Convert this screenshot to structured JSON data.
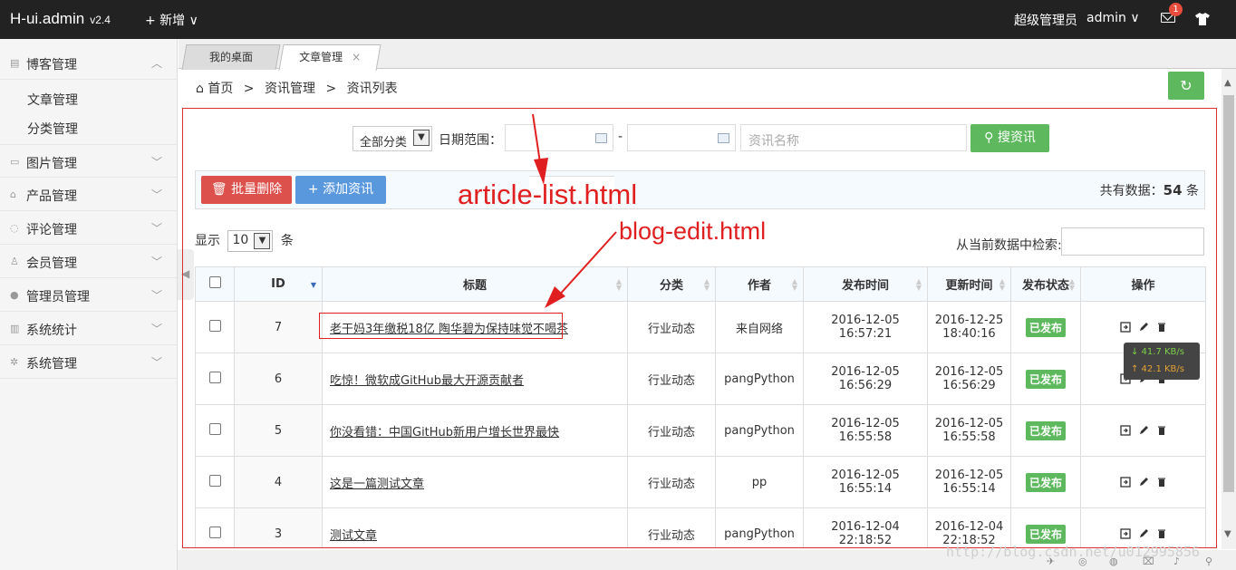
{
  "header": {
    "brand": "H-ui.admin",
    "version": "v2.4",
    "new_label": "+ 新增 ∨",
    "user_role": "超级管理员",
    "user_name": "admin ∨",
    "mail_count": "1"
  },
  "sidebar": {
    "items": [
      {
        "label": "博客管理",
        "icon": "blog-icon",
        "expanded": true
      },
      {
        "label": "图片管理",
        "icon": "picture-icon"
      },
      {
        "label": "产品管理",
        "icon": "product-icon"
      },
      {
        "label": "评论管理",
        "icon": "comment-icon"
      },
      {
        "label": "会员管理",
        "icon": "member-icon"
      },
      {
        "label": "管理员管理",
        "icon": "admin-icon"
      },
      {
        "label": "系统统计",
        "icon": "stats-icon"
      },
      {
        "label": "系统管理",
        "icon": "settings-icon"
      }
    ],
    "sub_items": [
      "文章管理",
      "分类管理"
    ]
  },
  "tabs": [
    {
      "label": "我的桌面"
    },
    {
      "label": "文章管理",
      "close": "×"
    }
  ],
  "breadcrumb": [
    "首页",
    "资讯管理",
    "资讯列表"
  ],
  "breadcrumb_sep": ">",
  "filter": {
    "category": "全部分类",
    "date_label": "日期范围：",
    "date_dash": "-",
    "name_placeholder": "资讯名称",
    "search_label": "搜资讯"
  },
  "toolbar": {
    "batch_delete": "批量删除",
    "add_article": "添加资讯",
    "total_prefix": "共有数据：",
    "total_count": "54",
    "total_suffix": " 条"
  },
  "list_controls": {
    "show_prefix": "显示",
    "page_size": "10",
    "show_suffix": "条",
    "search_label": "从当前数据中检索:"
  },
  "table": {
    "headers": [
      "ID",
      "标题",
      "分类",
      "作者",
      "发布时间",
      "更新时间",
      "发布状态",
      "操作"
    ],
    "rows": [
      {
        "id": "7",
        "title": "老干妈3年缴税18亿 陶华碧为保持味觉不喝茶",
        "category": "行业动态",
        "author": "来自网络",
        "published": "2016-12-05 16:57:21",
        "updated_date": "2016-12-25",
        "updated_time": "18:40:16",
        "status": "已发布"
      },
      {
        "id": "6",
        "title": "吃惊！微软成GitHub最大开源贡献者",
        "category": "行业动态",
        "author": "pangPython",
        "published": "2016-12-05 16:56:29",
        "updated_date": "2016-12-05",
        "updated_time": "16:56:29",
        "status": "已发布"
      },
      {
        "id": "5",
        "title": "你没看错：中国GitHub新用户增长世界最快",
        "category": "行业动态",
        "author": "pangPython",
        "published": "2016-12-05 16:55:58",
        "updated_date": "2016-12-05",
        "updated_time": "16:55:58",
        "status": "已发布"
      },
      {
        "id": "4",
        "title": "这是一篇测试文章",
        "category": "行业动态",
        "author": "pp",
        "published": "2016-12-05 16:55:14",
        "updated_date": "2016-12-05",
        "updated_time": "16:55:14",
        "status": "已发布"
      },
      {
        "id": "3",
        "title": "测试文章",
        "category": "行业动态",
        "author": "pangPython",
        "published": "2016-12-04 22:18:52",
        "updated_date": "2016-12-04",
        "updated_time": "22:18:52",
        "status": "已发布"
      }
    ]
  },
  "annotations": {
    "article_list": "article-list.html",
    "blog_edit": "blog-edit.html"
  },
  "speed": {
    "down": "↓ 41.7 KB/s",
    "up": "↑ 42.1 KB/s"
  },
  "watermark": "http://blog.csdn.net/u012995856",
  "colors": {
    "topbar": "#222222",
    "success": "#5eb95e",
    "danger": "#dd514c",
    "primary": "#5a98de",
    "annotation": "#e02020"
  }
}
